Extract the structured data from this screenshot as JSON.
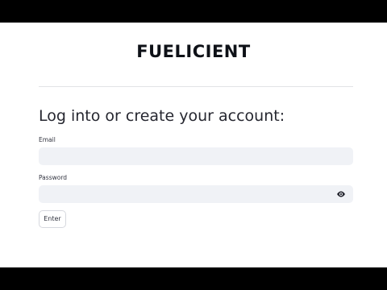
{
  "header": {
    "brand": "FUELICIENT"
  },
  "login": {
    "heading": "Log into or create your account:",
    "email_label": "Email",
    "email_value": "",
    "password_label": "Password",
    "password_value": "",
    "password_toggle_icon": "eye-icon",
    "submit_label": "Enter"
  },
  "colors": {
    "background": "#ffffff",
    "input_background": "#f0f2f6",
    "text": "#262730",
    "divider": "#e2e3e6"
  }
}
